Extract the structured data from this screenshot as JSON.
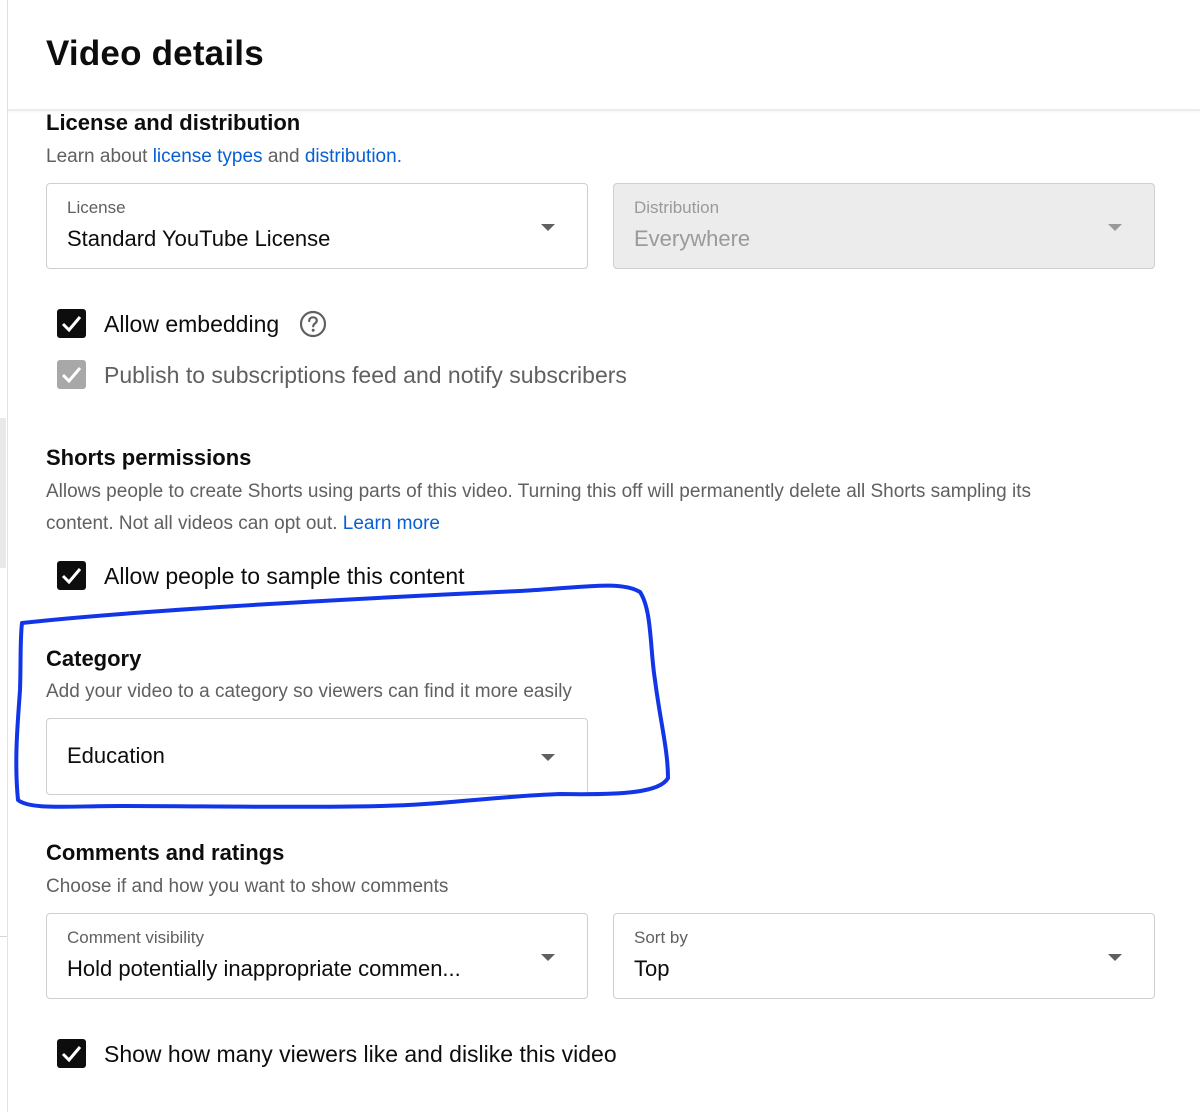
{
  "header": {
    "title": "Video details"
  },
  "license_section": {
    "title": "License and distribution",
    "subtitle_prefix": "Learn about ",
    "link_license_types": "license types",
    "subtitle_middle": " and ",
    "link_distribution": "distribution.",
    "license": {
      "label": "License",
      "value": "Standard YouTube License"
    },
    "distribution": {
      "label": "Distribution",
      "value": "Everywhere"
    },
    "allow_embedding": {
      "label": "Allow embedding",
      "checked": true
    },
    "publish_feed": {
      "label": "Publish to subscriptions feed and notify subscribers",
      "checked": true
    }
  },
  "shorts_section": {
    "title": "Shorts permissions",
    "description_line1": "Allows people to create Shorts using parts of this video. Turning this off will permanently delete all Shorts sampling its",
    "description_line2": "content. Not all videos can opt out. ",
    "learn_more": "Learn more",
    "allow_sample": {
      "label": "Allow people to sample this content",
      "checked": true
    }
  },
  "category_section": {
    "title": "Category",
    "subtitle": "Add your video to a category so viewers can find it more easily",
    "value": "Education",
    "annotation_color": "#1136e8"
  },
  "comments_section": {
    "title": "Comments and ratings",
    "subtitle": "Choose if and how you want to show comments",
    "comment_visibility": {
      "label": "Comment visibility",
      "value": "Hold potentially inappropriate commen..."
    },
    "sort_by": {
      "label": "Sort by",
      "value": "Top"
    },
    "show_likes": {
      "label": "Show how many viewers like and dislike this video",
      "checked": true
    }
  },
  "icons": [
    "check-icon",
    "help-circle-icon",
    "caret-down-icon"
  ]
}
